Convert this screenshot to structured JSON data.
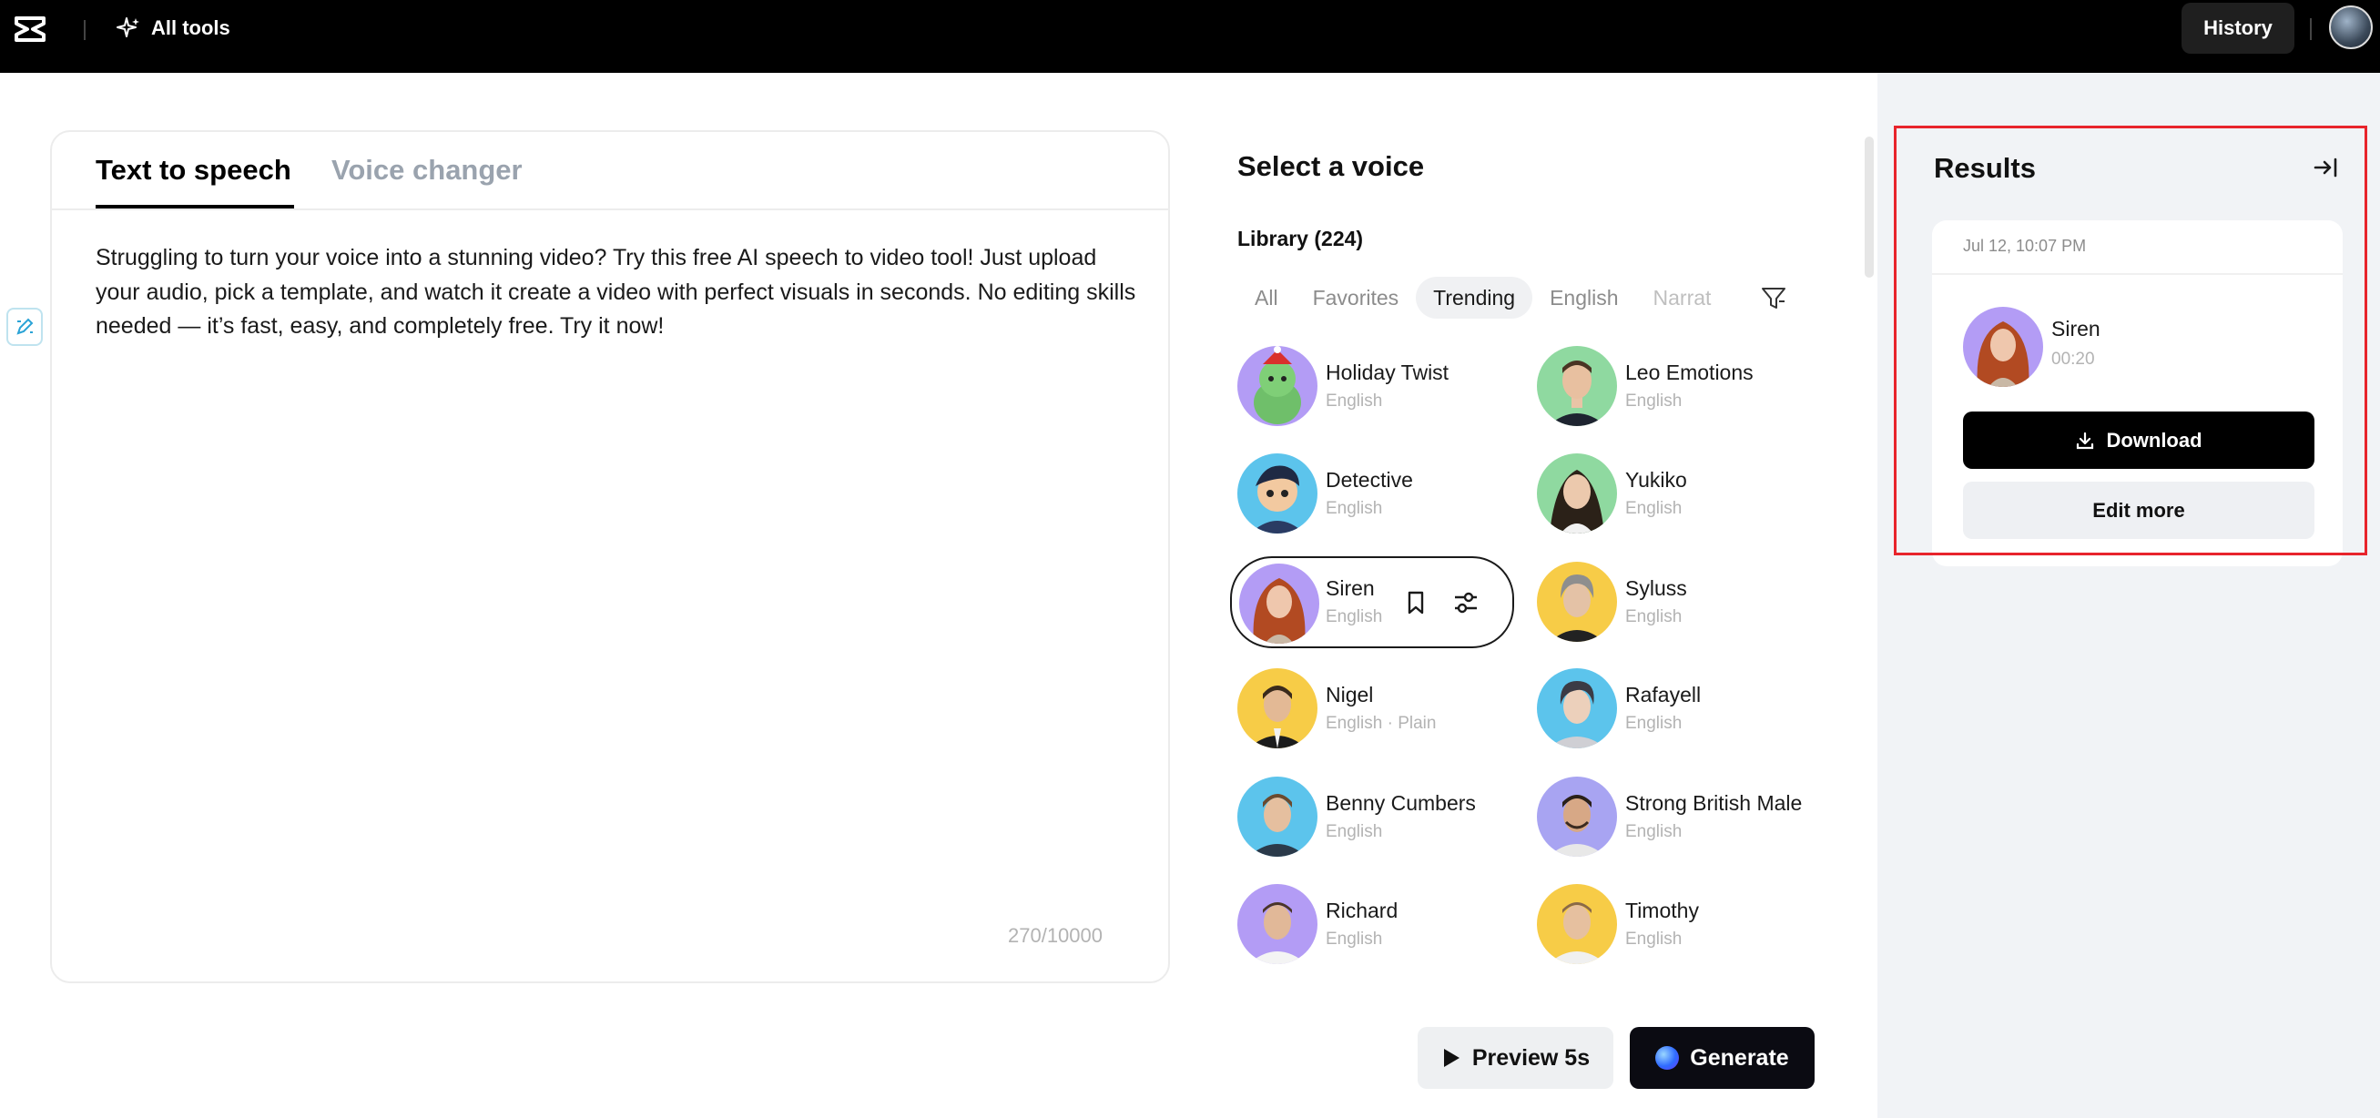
{
  "topbar": {
    "all_tools_label": "All tools",
    "history_label": "History",
    "logo_icon": "capcut-logo-icon",
    "sparkle_icon": "sparkle-icon"
  },
  "editor": {
    "tabs": [
      {
        "label": "Text to speech",
        "active": true
      },
      {
        "label": "Voice changer",
        "active": false
      }
    ],
    "text": "Struggling to turn your voice into a stunning video? Try this free AI speech to video tool! Just upload your audio, pick a template, and watch it create a video with perfect visuals in seconds. No editing skills needed — it’s fast, easy, and completely free. Try it now!",
    "counter": "270/10000"
  },
  "voices": {
    "title": "Select a voice",
    "library_label": "Library (224)",
    "filters": [
      {
        "label": "All",
        "active": false
      },
      {
        "label": "Favorites",
        "active": false
      },
      {
        "label": "Trending",
        "active": true
      },
      {
        "label": "English",
        "active": false
      },
      {
        "label": "Narrat",
        "active": false
      }
    ],
    "items": [
      {
        "name": "Holiday Twist",
        "sub": "English"
      },
      {
        "name": "Leo Emotions",
        "sub": "English"
      },
      {
        "name": "Detective",
        "sub": "English"
      },
      {
        "name": "Yukiko",
        "sub": "English"
      },
      {
        "name": "Siren",
        "sub": "English"
      },
      {
        "name": "Syluss",
        "sub": "English"
      },
      {
        "name": "Nigel",
        "sub": "English · Plain"
      },
      {
        "name": "Rafayell",
        "sub": "English"
      },
      {
        "name": "Benny Cumbers",
        "sub": "English"
      },
      {
        "name": "Strong British Male",
        "sub": "English"
      },
      {
        "name": "Richard",
        "sub": "English"
      },
      {
        "name": "Timothy",
        "sub": "English"
      }
    ],
    "selected_voice": "Siren"
  },
  "actions": {
    "preview_label": "Preview 5s",
    "generate_label": "Generate"
  },
  "results": {
    "title": "Results",
    "date": "Jul 12, 10:07 PM",
    "voice_name": "Siren",
    "duration": "00:20",
    "download_label": "Download",
    "edit_more_label": "Edit more"
  },
  "colors": {
    "topbar_bg": "#000000",
    "results_bg": "#f1f3f6",
    "highlight": "#e8242c",
    "avatar_purple": "#b39cf5",
    "avatar_green": "#8fd9a0",
    "avatar_blue": "#5cc4ec",
    "avatar_yellow": "#f7cc47"
  }
}
